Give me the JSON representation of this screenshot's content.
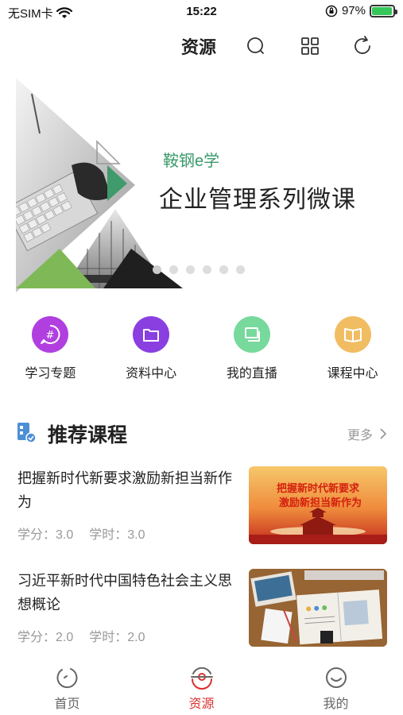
{
  "status_bar": {
    "carrier": "无SIM卡",
    "time": "15:22",
    "battery": "97%",
    "battery_level": 0.97
  },
  "header": {
    "title": "资源",
    "icons": [
      "search-icon",
      "grid-icon",
      "refresh-icon"
    ]
  },
  "banner": {
    "subtitle": "鞍钢e学",
    "title": "企业管理系列微课",
    "slide_count": 6,
    "active_slide": 0
  },
  "quick_menu": [
    {
      "label": "学习专题",
      "icon": "hashtag-chat-icon",
      "color": "#b13fe0"
    },
    {
      "label": "资料中心",
      "icon": "folder-icon",
      "color": "#8a3fe0"
    },
    {
      "label": "我的直播",
      "icon": "live-screens-icon",
      "color": "#78d99d"
    },
    {
      "label": "课程中心",
      "icon": "book-icon",
      "color": "#f1bd63"
    }
  ],
  "section": {
    "title": "推荐课程",
    "more": "更多"
  },
  "courses": [
    {
      "title": "把握新时代新要求激励新担当新作为",
      "credit_label": "学分：",
      "credit": "3.0",
      "hours_label": "学时：",
      "hours": "3.0",
      "thumb_lines": [
        "把握新时代新要求",
        "激励新担当新作为"
      ]
    },
    {
      "title": "习近平新时代中国特色社会主义思想概论",
      "credit_label": "学分：",
      "credit": "2.0",
      "hours_label": "学时：",
      "hours": "2.0",
      "thumb_lines": []
    }
  ],
  "tab_bar": [
    {
      "label": "首页",
      "icon": "home-icon",
      "active": false
    },
    {
      "label": "资源",
      "icon": "resource-icon",
      "active": true
    },
    {
      "label": "我的",
      "icon": "profile-icon",
      "active": false
    }
  ],
  "colors": {
    "accent": "#d9312f",
    "banner_green": "#3a9a6a"
  }
}
